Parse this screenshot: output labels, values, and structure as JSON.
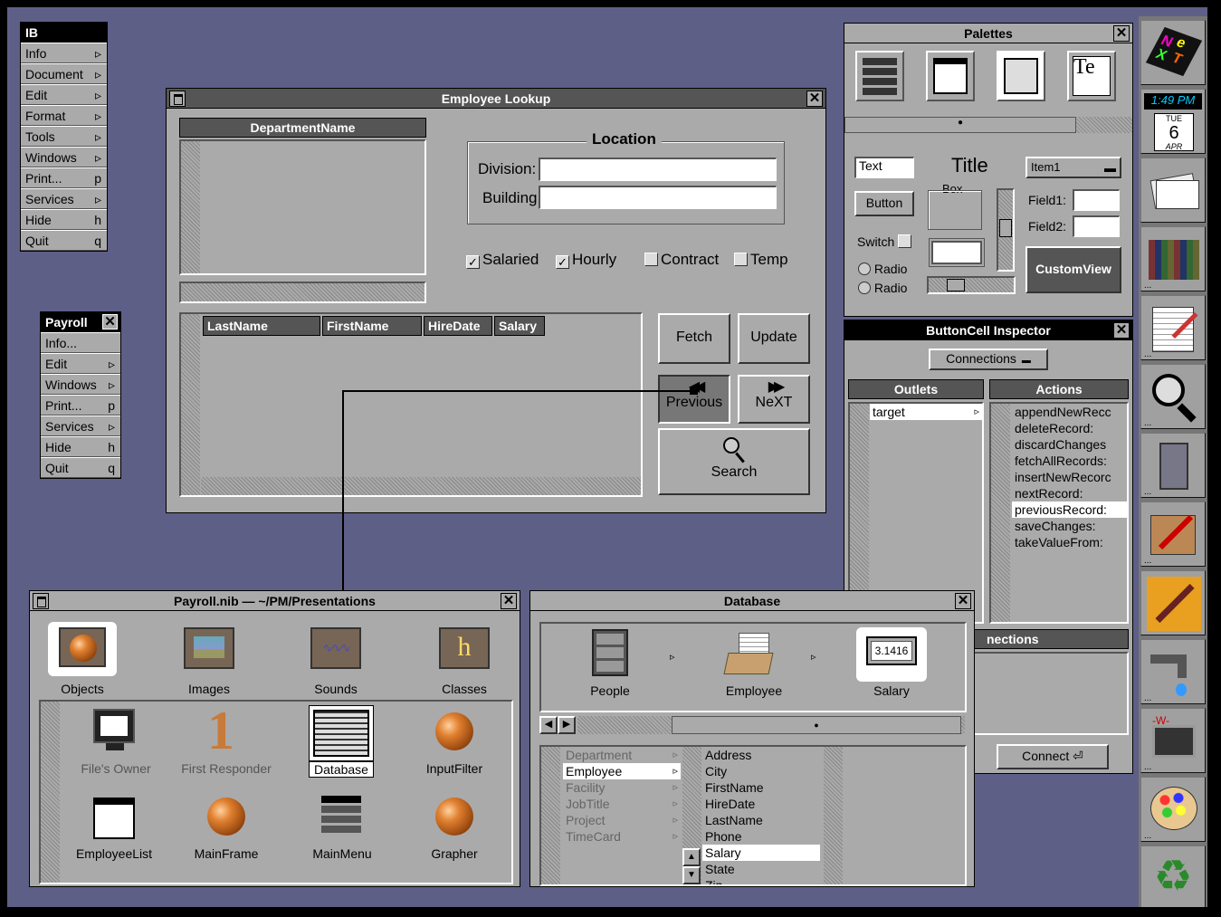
{
  "colors": {
    "desktop": "#5e5f87",
    "window": "#aaaaaa",
    "title_active": "#000000",
    "title_inactive": "#555555",
    "field": "#ffffff"
  },
  "ib_menu": {
    "title": "IB",
    "items": [
      {
        "label": "Info",
        "key": "▹"
      },
      {
        "label": "Document",
        "key": "▹"
      },
      {
        "label": "Edit",
        "key": "▹"
      },
      {
        "label": "Format",
        "key": "▹"
      },
      {
        "label": "Tools",
        "key": "▹"
      },
      {
        "label": "Windows",
        "key": "▹"
      },
      {
        "label": "Print...",
        "key": "p"
      },
      {
        "label": "Services",
        "key": "▹"
      },
      {
        "label": "Hide",
        "key": "h"
      },
      {
        "label": "Quit",
        "key": "q"
      }
    ]
  },
  "payroll_menu": {
    "title": "Payroll",
    "items": [
      {
        "label": "Info...",
        "key": ""
      },
      {
        "label": "Edit",
        "key": "▹"
      },
      {
        "label": "Windows",
        "key": "▹"
      },
      {
        "label": "Print...",
        "key": "p"
      },
      {
        "label": "Services",
        "key": "▹"
      },
      {
        "label": "Hide",
        "key": "h"
      },
      {
        "label": "Quit",
        "key": "q"
      }
    ]
  },
  "employee_lookup": {
    "title": "Employee Lookup",
    "dept_header": "DepartmentName",
    "location_title": "Location",
    "division_label": "Division:",
    "division_value": "",
    "building_label": "Building",
    "building_value": "",
    "checkboxes": [
      {
        "label": "Salaried",
        "checked": true
      },
      {
        "label": "Hourly",
        "checked": true
      },
      {
        "label": "Contract",
        "checked": false
      },
      {
        "label": "Temp",
        "checked": false
      }
    ],
    "columns": [
      "LastName",
      "FirstName",
      "HireDate",
      "Salary"
    ],
    "buttons": {
      "fetch": "Fetch",
      "update": "Update",
      "previous": "Previous",
      "next": "NeXT",
      "search": "Search"
    }
  },
  "palettes": {
    "title": "Palettes",
    "text_field": "Text",
    "title_label": "Title",
    "popup": "Item1",
    "box": "Box",
    "button": "Button",
    "field1": "Field1:",
    "field2": "Field2:",
    "switch": "Switch",
    "radio1": "Radio",
    "radio2": "Radio",
    "customview": "CustomView"
  },
  "inspector": {
    "title": "ButtonCell Inspector",
    "popup": "Connections",
    "outlets_header": "Outlets",
    "actions_header": "Actions",
    "outlets": [
      "target"
    ],
    "actions": [
      "appendNewRecc",
      "deleteRecord:",
      "discardChanges",
      "fetchAllRecords:",
      "insertNewRecorc",
      "nextRecord:",
      "previousRecord:",
      "saveChanges:",
      "takeValueFrom:"
    ],
    "selected_action": "previousRecord:",
    "connections_label": "nections",
    "connect_button": "Connect"
  },
  "nib": {
    "title": "Payroll.nib  —  ~/PM/Presentations",
    "tabs": [
      "Objects",
      "Images",
      "Sounds",
      "Classes"
    ],
    "objects": [
      "File's Owner",
      "First Responder",
      "Database",
      "InputFilter",
      "EmployeeList",
      "MainFrame",
      "MainMenu",
      "Grapher"
    ],
    "selected": "Database"
  },
  "database": {
    "title": "Database",
    "path": [
      "People",
      "Employee",
      "Salary"
    ],
    "salary_icon_text": "3.1416",
    "entities": [
      "Department",
      "Employee",
      "Facility",
      "JobTitle",
      "Project",
      "TimeCard"
    ],
    "selected_entity": "Employee",
    "attributes": [
      "Address",
      "City",
      "FirstName",
      "HireDate",
      "LastName",
      "Phone",
      "Salary",
      "State",
      "Zip"
    ],
    "selected_attribute": "Salary"
  },
  "dock": {
    "clock": "1:49 PM",
    "day": "TUE",
    "date": "6",
    "month": "APR",
    "icons": [
      "next-logo-icon",
      "clock-icon",
      "mail-icon",
      "books-icon",
      "editor-icon",
      "magnifier-icon",
      "cabinet-icon",
      "tools-icon",
      "screwdriver-icon",
      "faucet-icon",
      "monitor-icon",
      "palette-icon",
      "recycle-icon"
    ]
  }
}
